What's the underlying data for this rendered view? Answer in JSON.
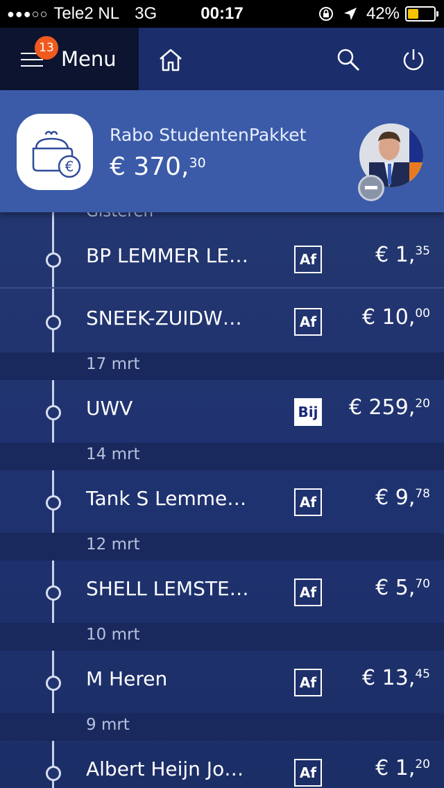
{
  "status_bar": {
    "signal": "●●●○○",
    "carrier": "Tele2 NL",
    "network": "3G",
    "time": "00:17",
    "battery": "42%",
    "battery_level": 0.42
  },
  "navbar": {
    "menu_label": "Menu",
    "notification_count": "13",
    "icons": [
      "home-icon",
      "search-icon",
      "power-icon"
    ]
  },
  "account": {
    "name": "Rabo StudentenPakket",
    "balance_main": "€ 370,",
    "balance_cents": "30",
    "icon": "wallet-euro-icon"
  },
  "transactions": {
    "cut_date": "Gisteren",
    "rows": [
      {
        "desc": "BP LEMMER LE…",
        "type": "Af",
        "amount_main": "€ 1,",
        "amount_cents": "35"
      },
      {
        "desc": "SNEEK-ZUIDW…",
        "type": "Af",
        "amount_main": "€ 10,",
        "amount_cents": "00"
      },
      {
        "date": "17 mrt"
      },
      {
        "desc": "UWV",
        "type": "Bij",
        "amount_main": "€ 259,",
        "amount_cents": "20"
      },
      {
        "date": "14 mrt"
      },
      {
        "desc": "Tank S Lemme…",
        "type": "Af",
        "amount_main": "€ 9,",
        "amount_cents": "78"
      },
      {
        "date": "12 mrt"
      },
      {
        "desc": "SHELL LEMSTE…",
        "type": "Af",
        "amount_main": "€ 5,",
        "amount_cents": "70"
      },
      {
        "date": "10 mrt"
      },
      {
        "desc": "M Heren",
        "type": "Af",
        "amount_main": "€ 13,",
        "amount_cents": "45"
      },
      {
        "date": "9 mrt"
      },
      {
        "desc": "Albert Heijn Jo…",
        "type": "Af",
        "amount_main": "€ 1,",
        "amount_cents": "20"
      }
    ]
  },
  "colors": {
    "accent_orange": "#f05a1e",
    "account_header": "#3b5ba8",
    "background": "#1a2a6c",
    "battery": "#f5c400"
  }
}
